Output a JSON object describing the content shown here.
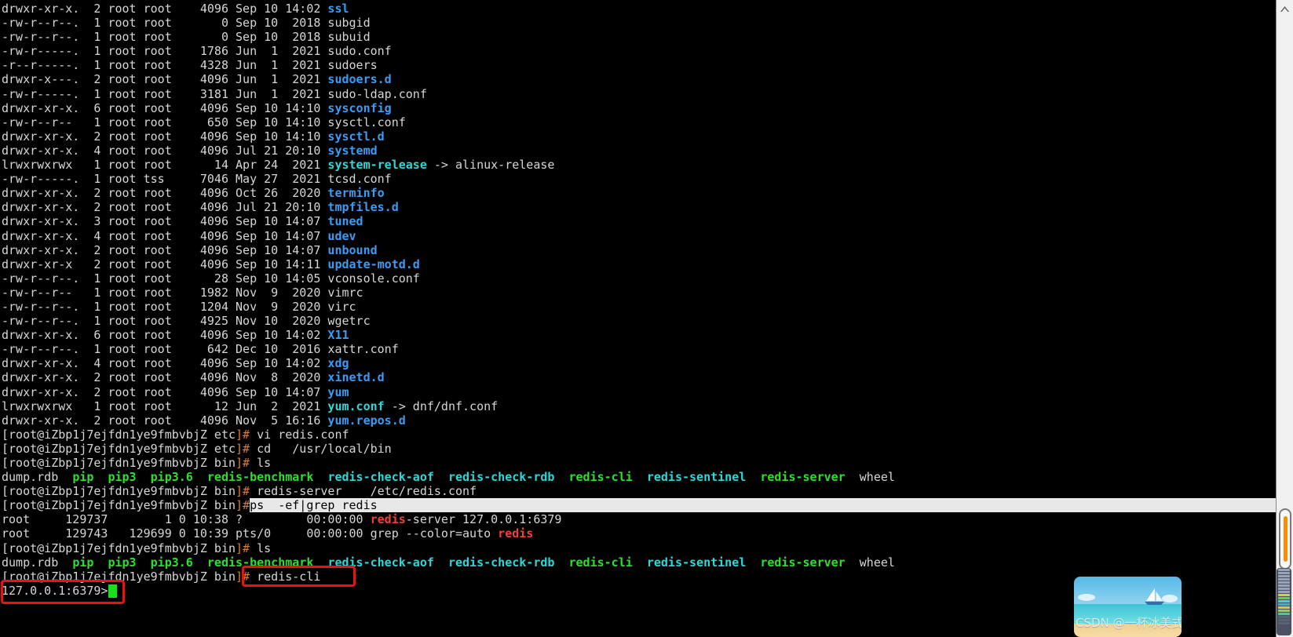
{
  "terminal": {
    "prompt_user_host": "[root@iZbp1j7ejfdn1ye9fmbvbjZ",
    "hostname": "iZbp1j7ejfdn1ye9fmbvbjZ",
    "listing": [
      {
        "perm": "drwxr-xr-x.",
        "links": "2",
        "owner": "root",
        "group": "root",
        "size": "4096",
        "month": "Sep",
        "day": "10",
        "time": "14:02",
        "name": "ssl",
        "type": "dir"
      },
      {
        "perm": "-rw-r--r--.",
        "links": "1",
        "owner": "root",
        "group": "root",
        "size": "0",
        "month": "Sep",
        "day": "10",
        "time": "2018",
        "name": "subgid",
        "type": "file"
      },
      {
        "perm": "-rw-r--r--.",
        "links": "1",
        "owner": "root",
        "group": "root",
        "size": "0",
        "month": "Sep",
        "day": "10",
        "time": "2018",
        "name": "subuid",
        "type": "file"
      },
      {
        "perm": "-rw-r-----.",
        "links": "1",
        "owner": "root",
        "group": "root",
        "size": "1786",
        "month": "Jun",
        "day": "1",
        "time": "2021",
        "name": "sudo.conf",
        "type": "file"
      },
      {
        "perm": "-r--r-----.",
        "links": "1",
        "owner": "root",
        "group": "root",
        "size": "4328",
        "month": "Jun",
        "day": "1",
        "time": "2021",
        "name": "sudoers",
        "type": "file"
      },
      {
        "perm": "drwxr-x---.",
        "links": "2",
        "owner": "root",
        "group": "root",
        "size": "4096",
        "month": "Jun",
        "day": "1",
        "time": "2021",
        "name": "sudoers.d",
        "type": "dir"
      },
      {
        "perm": "-rw-r-----.",
        "links": "1",
        "owner": "root",
        "group": "root",
        "size": "3181",
        "month": "Jun",
        "day": "1",
        "time": "2021",
        "name": "sudo-ldap.conf",
        "type": "file"
      },
      {
        "perm": "drwxr-xr-x.",
        "links": "6",
        "owner": "root",
        "group": "root",
        "size": "4096",
        "month": "Sep",
        "day": "10",
        "time": "14:10",
        "name": "sysconfig",
        "type": "dir"
      },
      {
        "perm": "-rw-r--r--",
        "links": "1",
        "owner": "root",
        "group": "root",
        "size": "650",
        "month": "Sep",
        "day": "10",
        "time": "14:10",
        "name": "sysctl.conf",
        "type": "file"
      },
      {
        "perm": "drwxr-xr-x.",
        "links": "2",
        "owner": "root",
        "group": "root",
        "size": "4096",
        "month": "Sep",
        "day": "10",
        "time": "14:10",
        "name": "sysctl.d",
        "type": "dir"
      },
      {
        "perm": "drwxr-xr-x.",
        "links": "4",
        "owner": "root",
        "group": "root",
        "size": "4096",
        "month": "Jul",
        "day": "21",
        "time": "20:10",
        "name": "systemd",
        "type": "dir"
      },
      {
        "perm": "lrwxrwxrwx",
        "links": "1",
        "owner": "root",
        "group": "root",
        "size": "14",
        "month": "Apr",
        "day": "24",
        "time": "2021",
        "name": "system-release",
        "type": "link",
        "target": "alinux-release"
      },
      {
        "perm": "-rw-r-----.",
        "links": "1",
        "owner": "root",
        "group": "tss",
        "size": "7046",
        "month": "May",
        "day": "27",
        "time": "2021",
        "name": "tcsd.conf",
        "type": "file"
      },
      {
        "perm": "drwxr-xr-x.",
        "links": "2",
        "owner": "root",
        "group": "root",
        "size": "4096",
        "month": "Oct",
        "day": "26",
        "time": "2020",
        "name": "terminfo",
        "type": "dir"
      },
      {
        "perm": "drwxr-xr-x.",
        "links": "2",
        "owner": "root",
        "group": "root",
        "size": "4096",
        "month": "Jul",
        "day": "21",
        "time": "20:10",
        "name": "tmpfiles.d",
        "type": "dir"
      },
      {
        "perm": "drwxr-xr-x.",
        "links": "3",
        "owner": "root",
        "group": "root",
        "size": "4096",
        "month": "Sep",
        "day": "10",
        "time": "14:07",
        "name": "tuned",
        "type": "dir"
      },
      {
        "perm": "drwxr-xr-x.",
        "links": "4",
        "owner": "root",
        "group": "root",
        "size": "4096",
        "month": "Sep",
        "day": "10",
        "time": "14:07",
        "name": "udev",
        "type": "dir"
      },
      {
        "perm": "drwxr-xr-x.",
        "links": "2",
        "owner": "root",
        "group": "root",
        "size": "4096",
        "month": "Sep",
        "day": "10",
        "time": "14:07",
        "name": "unbound",
        "type": "dir"
      },
      {
        "perm": "drwxr-xr-x",
        "links": "2",
        "owner": "root",
        "group": "root",
        "size": "4096",
        "month": "Sep",
        "day": "10",
        "time": "14:11",
        "name": "update-motd.d",
        "type": "dir"
      },
      {
        "perm": "-rw-r--r--.",
        "links": "1",
        "owner": "root",
        "group": "root",
        "size": "28",
        "month": "Sep",
        "day": "10",
        "time": "14:05",
        "name": "vconsole.conf",
        "type": "file"
      },
      {
        "perm": "-rw-r--r--",
        "links": "1",
        "owner": "root",
        "group": "root",
        "size": "1982",
        "month": "Nov",
        "day": "9",
        "time": "2020",
        "name": "vimrc",
        "type": "file"
      },
      {
        "perm": "-rw-r--r--.",
        "links": "1",
        "owner": "root",
        "group": "root",
        "size": "1204",
        "month": "Nov",
        "day": "9",
        "time": "2020",
        "name": "virc",
        "type": "file"
      },
      {
        "perm": "-rw-r--r--.",
        "links": "1",
        "owner": "root",
        "group": "root",
        "size": "4925",
        "month": "Nov",
        "day": "10",
        "time": "2020",
        "name": "wgetrc",
        "type": "file"
      },
      {
        "perm": "drwxr-xr-x.",
        "links": "6",
        "owner": "root",
        "group": "root",
        "size": "4096",
        "month": "Sep",
        "day": "10",
        "time": "14:02",
        "name": "X11",
        "type": "dir"
      },
      {
        "perm": "-rw-r--r--.",
        "links": "1",
        "owner": "root",
        "group": "root",
        "size": "642",
        "month": "Dec",
        "day": "10",
        "time": "2016",
        "name": "xattr.conf",
        "type": "file"
      },
      {
        "perm": "drwxr-xr-x.",
        "links": "4",
        "owner": "root",
        "group": "root",
        "size": "4096",
        "month": "Sep",
        "day": "10",
        "time": "14:02",
        "name": "xdg",
        "type": "dir"
      },
      {
        "perm": "drwxr-xr-x.",
        "links": "2",
        "owner": "root",
        "group": "root",
        "size": "4096",
        "month": "Nov",
        "day": "8",
        "time": "2020",
        "name": "xinetd.d",
        "type": "dir"
      },
      {
        "perm": "drwxr-xr-x.",
        "links": "2",
        "owner": "root",
        "group": "root",
        "size": "4096",
        "month": "Sep",
        "day": "10",
        "time": "14:07",
        "name": "yum",
        "type": "dir"
      },
      {
        "perm": "lrwxrwxrwx",
        "links": "1",
        "owner": "root",
        "group": "root",
        "size": "12",
        "month": "Jun",
        "day": "2",
        "time": "2021",
        "name": "yum.conf",
        "type": "link",
        "target": "dnf/dnf.conf"
      },
      {
        "perm": "drwxr-xr-x.",
        "links": "2",
        "owner": "root",
        "group": "root",
        "size": "4096",
        "month": "Nov",
        "day": "5",
        "time": "16:16",
        "name": "yum.repos.d",
        "type": "dir"
      }
    ],
    "commands": {
      "cwd_etc": "etc]#",
      "cwd_bin": "bin]#",
      "vi_redis_conf": " vi redis.conf",
      "cd_usr_local_bin": " cd   /usr/local/bin",
      "ls": " ls",
      "redis_server": " redis-server    /etc/redis.conf",
      "ps_grep_redis": "ps  -ef|grep redis",
      "redis_cli": "redis-cli"
    },
    "bin_listing": [
      {
        "name": "dump.rdb",
        "type": "file"
      },
      {
        "name": "pip",
        "type": "exe"
      },
      {
        "name": "pip3",
        "type": "exe"
      },
      {
        "name": "pip3.6",
        "type": "exe"
      },
      {
        "name": "redis-benchmark",
        "type": "exe"
      },
      {
        "name": "redis-check-aof",
        "type": "link"
      },
      {
        "name": "redis-check-rdb",
        "type": "link"
      },
      {
        "name": "redis-cli",
        "type": "exe"
      },
      {
        "name": "redis-sentinel",
        "type": "link"
      },
      {
        "name": "redis-server",
        "type": "exe"
      },
      {
        "name": "wheel",
        "type": "file"
      }
    ],
    "ps_output": [
      {
        "user": "root",
        "pid": "129737",
        "ppid": "1",
        "c": "0",
        "stime": "10:38",
        "tty": "?",
        "time": "00:00:00",
        "cmd_match": "redis",
        "cmd_rest": "-server 127.0.0.1:6379"
      },
      {
        "user": "root",
        "pid": "129743",
        "ppid": "129699",
        "c": "0",
        "stime": "10:39",
        "tty": "pts/0",
        "time": "00:00:00",
        "cmd_pre": "grep --color=auto ",
        "cmd_match": "redis",
        "cmd_rest": ""
      }
    ],
    "redis_prompt": "127.0.0.1:6379>"
  },
  "annotations": {
    "box_redis_cli_label": "redis-cli",
    "box_prompt_label": "127.0.0.1:6379>",
    "box_color": "#f01010"
  },
  "scrollbar": {
    "up_arrow": "scroll-up-arrow",
    "down_arrow": "scroll-down-arrow",
    "thumb_color": "#ff8b00"
  },
  "watermark": {
    "text": "CSDN @一杯冰美式sir"
  },
  "colors": {
    "background": "#000000",
    "foreground": "#d6d6d6",
    "directory": "#3b9cf5",
    "symlink": "#2fd7d7",
    "executable": "#2ee02e",
    "grep_match": "#f2403a",
    "prompt_hash": "#e07b28",
    "selection_bg": "#e8e8e8"
  }
}
